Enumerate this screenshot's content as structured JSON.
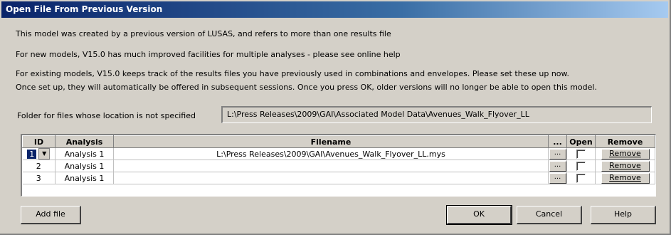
{
  "dialog": {
    "title": "Open File From Previous Version",
    "messages": [
      "This model was created by a previous version of LUSAS, and refers to more than one results file",
      "For new models, V15.0 has much improved facilities for multiple analyses - please see online help",
      "For existing models, V15.0 keeps track of the results files you have previously used in combinations and envelopes. Please set these up now.",
      "Once set up, they will automatically be offered in subsequent sessions. Once you press OK, older versions will no longer be able to open this model."
    ],
    "folder": {
      "label": "Folder for files whose location is not specified",
      "value": "L:\\Press Releases\\2009\\GAI\\Associated Model Data\\Avenues_Walk_Flyover_LL"
    },
    "grid": {
      "headers": {
        "id": "ID",
        "analysis": "Analysis",
        "filename": "Filename",
        "browse": "...",
        "open": "Open",
        "remove": "Remove"
      },
      "rows": [
        {
          "id": "1",
          "analysis": "Analysis 1",
          "filename": "L:\\Press Releases\\2009\\GAI\\Avenues_Walk_Flyover_LL.mys",
          "browse": "...",
          "open": false,
          "remove": "Remove"
        },
        {
          "id": "2",
          "analysis": "Analysis 1",
          "filename": "",
          "browse": "...",
          "open": false,
          "remove": "Remove"
        },
        {
          "id": "3",
          "analysis": "Analysis 1",
          "filename": "",
          "browse": "...",
          "open": false,
          "remove": "Remove"
        }
      ]
    },
    "buttons": {
      "add_file": "Add file",
      "ok": "OK",
      "cancel": "Cancel",
      "help": "Help"
    }
  }
}
